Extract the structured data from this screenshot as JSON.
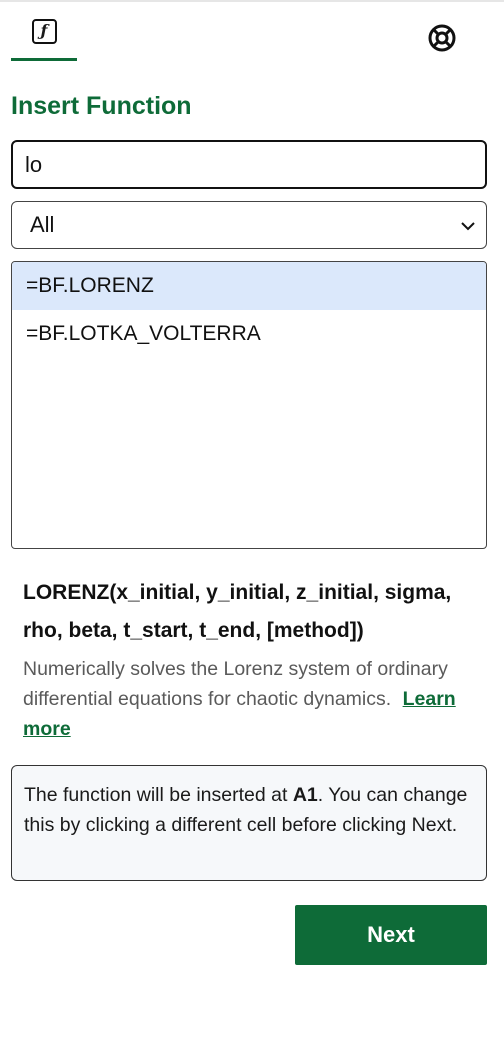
{
  "tabs": [
    {
      "icon": "function-icon",
      "label": "ƒ",
      "active": true
    },
    {
      "icon": "lifebuoy-icon",
      "active": false
    }
  ],
  "title": "Insert Function",
  "search": {
    "value": "lo",
    "placeholder": ""
  },
  "category": {
    "selected": "All"
  },
  "results": [
    {
      "label": "=BF.LORENZ",
      "selected": true
    },
    {
      "label": "=BF.LOTKA_VOLTERRA",
      "selected": false
    }
  ],
  "details": {
    "signature": "LORENZ(x_initial, y_initial, z_initial, sigma, rho, beta, t_start, t_end, [method])",
    "description": "Numerically solves the Lorenz system of ordinary differential equations for chaotic dynamics.",
    "learn_more": "Learn more"
  },
  "notice": {
    "prefix": "The function will be inserted at ",
    "cell": "A1",
    "suffix": ". You can change this by clicking a different cell before clicking Next."
  },
  "next_label": "Next",
  "colors": {
    "accent": "#0e6b38",
    "selected_row": "#dbe8fb",
    "notice_bg": "#f6f8fa"
  }
}
